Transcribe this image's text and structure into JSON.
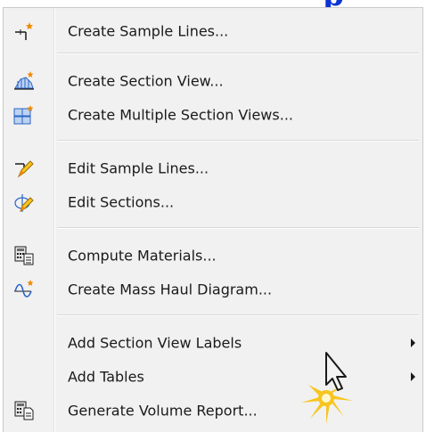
{
  "page_heading_fragment": "p",
  "menu": {
    "items": [
      {
        "label": "Create Sample Lines...",
        "icon": "create-sample-lines-icon"
      },
      {
        "label": "Create Section View...",
        "icon": "create-section-view-icon"
      },
      {
        "label": "Create Multiple Section Views...",
        "icon": "create-multiple-section-views-icon"
      },
      {
        "label": "Edit Sample Lines...",
        "icon": "edit-sample-lines-icon"
      },
      {
        "label": "Edit Sections...",
        "icon": "edit-sections-icon"
      },
      {
        "label": "Compute Materials...",
        "icon": "compute-materials-icon"
      },
      {
        "label": "Create Mass Haul Diagram...",
        "icon": "mass-haul-diagram-icon"
      },
      {
        "label": "Add Section View Labels",
        "submenu": true
      },
      {
        "label": "Add Tables",
        "submenu": true
      },
      {
        "label": "Generate Volume Report...",
        "icon": "volume-report-icon"
      }
    ]
  },
  "colors": {
    "menu_bg": "#f1f1f1",
    "heading_blue": "#0a33d6",
    "icon_blue": "#2a64c8",
    "icon_orange": "#f08a00",
    "highlight_yellow": "#f7c51e"
  }
}
